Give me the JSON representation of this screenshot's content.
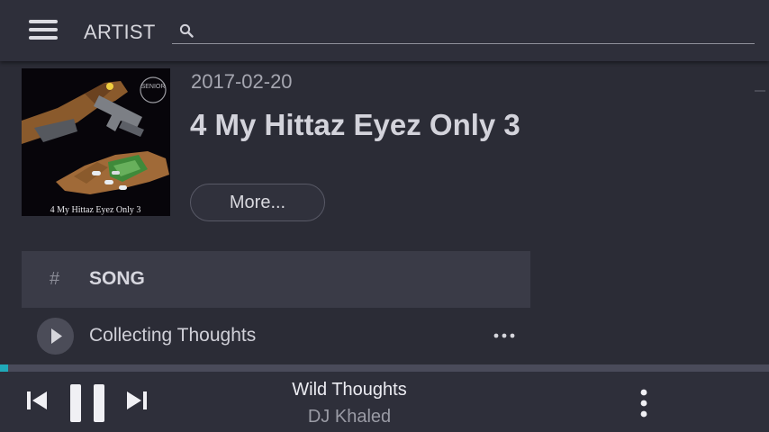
{
  "topbar": {
    "title": "ARTIST",
    "search_placeholder": "",
    "search_value": ""
  },
  "album": {
    "date": "2017-02-20",
    "title": "4 My Hittaz Eyez Only 3",
    "more_label": "More...",
    "cover_caption": "4 My Hittaz Eyez Only 3",
    "cover_stamp": "SENIOR"
  },
  "songs": {
    "header_num": "#",
    "header_song": "SONG",
    "rows": [
      {
        "title": "Collecting Thoughts"
      }
    ]
  },
  "player": {
    "track": "Wild Thoughts",
    "artist": "DJ Khaled",
    "progress": 0.01
  },
  "colors": {
    "background": "#2b2c36",
    "bar": "#2e2f3a",
    "accent": "#20a9b8",
    "header_row": "#3a3b47"
  },
  "icons": {
    "menu": "hamburger-menu-icon",
    "search": "search-icon",
    "play": "play-icon",
    "more": "more-horizontal-icon",
    "prev": "skip-previous-icon",
    "pause": "pause-icon",
    "next": "skip-next-icon",
    "overflow": "more-vertical-icon"
  }
}
